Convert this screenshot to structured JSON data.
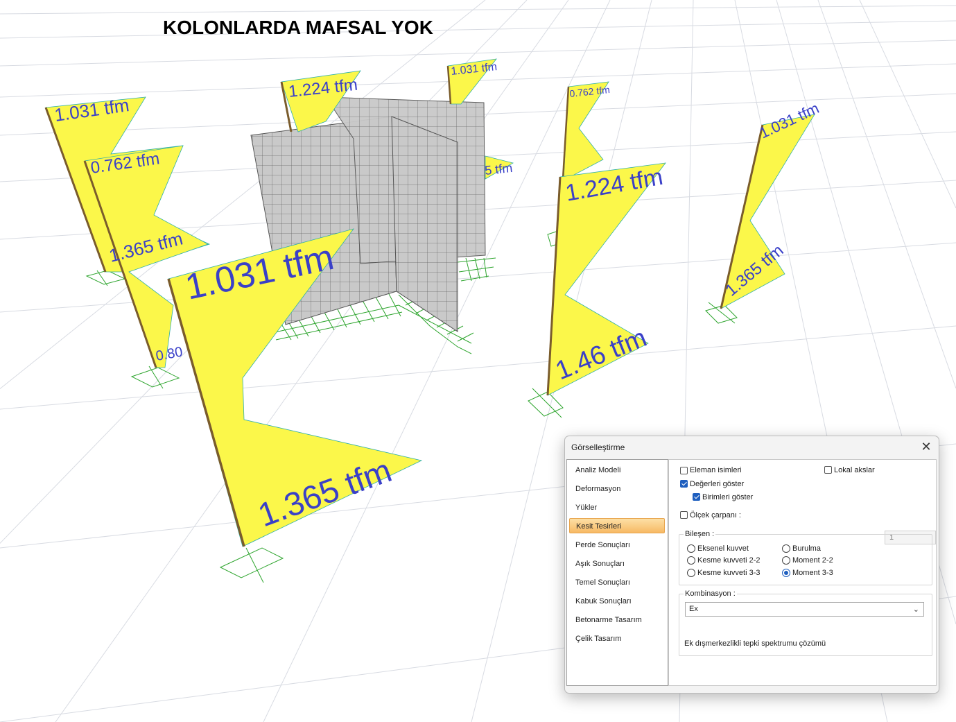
{
  "title": "KOLONLARDA MAFSAL YOK",
  "colors": {
    "diagram_fill": "#fbf74a",
    "diagram_label": "#3a40c8",
    "column": "#7a5c2c",
    "support": "#2ea52e",
    "wall": "#c8c8c8",
    "accent": "#1f5fbf",
    "selected_item": "#f7b964"
  },
  "diagram_labels": {
    "c1_top": "1.031 tfm",
    "c1_mid": "0.762 tfm",
    "c1_bot": "1.365 tfm",
    "c1_partial": "0.80",
    "c2_top": "1.031 tfm",
    "c2_bot": "1.365 tfm",
    "c3_top": "1.224 tfm",
    "c4_top": "1.031 tfm",
    "c4_partial": "5 tfm",
    "c5_top": "0.762 tfm",
    "c5_mid": "1.224 tfm",
    "c5_bot": "1.46 tfm",
    "c6_top": "1.031 tfm",
    "c6_bot": "1.365 tfm"
  },
  "dialog": {
    "title": "Görselleştirme",
    "close_icon": "close-icon",
    "nav": [
      {
        "label": "Analiz Modeli"
      },
      {
        "label": "Deformasyon"
      },
      {
        "label": "Yükler"
      },
      {
        "label": "Kesit Tesirleri",
        "selected": true
      },
      {
        "label": "Perde Sonuçları"
      },
      {
        "label": "Aşık Sonuçları"
      },
      {
        "label": "Temel Sonuçları"
      },
      {
        "label": "Kabuk Sonuçları"
      },
      {
        "label": "Betonarme Tasarım"
      },
      {
        "label": "Çelik Tasarım"
      }
    ],
    "options": {
      "eleman_isimleri": "Eleman isimleri",
      "lokal_akslar": "Lokal akslar",
      "degerleri_goster": "Değerleri göster",
      "birimleri_goster": "Birimleri göster",
      "olcek_carpani": "Ölçek çarpanı :",
      "olcek_value": "1"
    },
    "bilesen": {
      "title": "Bileşen :",
      "eksenel": "Eksenel kuvvet",
      "kesme22": "Kesme kuvveti 2-2",
      "kesme33": "Kesme kuvveti 3-3",
      "burulma": "Burulma",
      "moment22": "Moment 2-2",
      "moment33": "Moment 3-3",
      "selected": "Moment 3-3"
    },
    "kombinasyon": {
      "title": "Kombinasyon :",
      "value": "Ex",
      "description": "Ek dışmerkezlikli tepki spektrumu çözümü"
    }
  }
}
